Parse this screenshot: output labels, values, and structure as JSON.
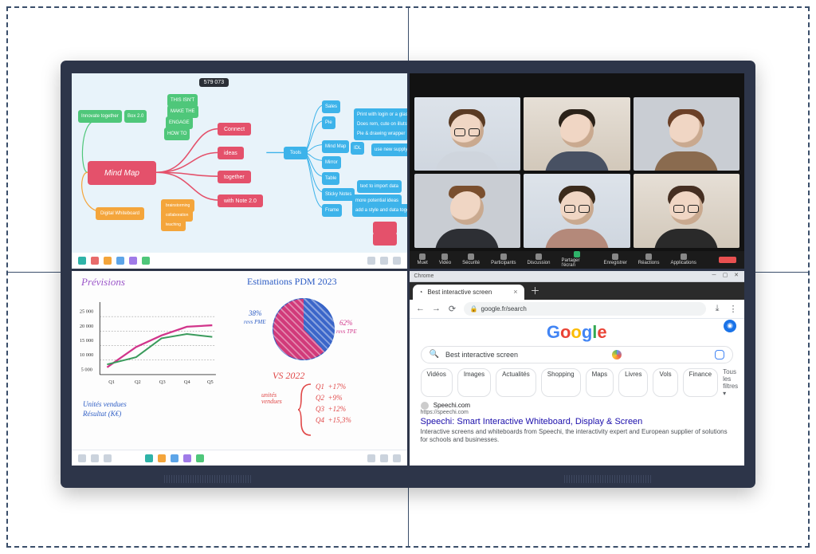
{
  "tl": {
    "badge": "579 073",
    "root": "Mind Map",
    "red_nodes": [
      "Connect",
      "ideas",
      "together",
      "with Note 2.0"
    ],
    "blue_center": "Tools",
    "blue_top": [
      "Sales",
      "Pie",
      "Mind Map",
      "Mirror",
      "Table",
      "Sticky Notes",
      "Frame"
    ],
    "blue_small": [
      "Print with login or a glass",
      "Does rem, cute on illutstre",
      "Pie & drawing wrapper",
      "IDL",
      "use new supply",
      "text to import data",
      "more potential ideas",
      "add a style and data together"
    ],
    "green_nodes": [
      "THIS ISN'T",
      "MAKE THE",
      "ENGAGE",
      "HOW TO"
    ],
    "green_box": "Box 2.0",
    "green_left": "Innovate together",
    "orange_root": "Digital Whiteboard",
    "orange_items": [
      "brainstorming",
      "collaboration",
      "teaching"
    ]
  },
  "tr": {
    "participants": [
      "",
      "",
      "",
      "",
      "",
      ""
    ],
    "controls": [
      "Muet",
      "Vidéo",
      "Sécurité",
      "Participants",
      "Discussion",
      "Partager l'écran",
      "Enregistrer",
      "Réactions",
      "Applications"
    ]
  },
  "bl": {
    "left_title": "Prévisions",
    "right_title": "Estimations PDM 2023",
    "ylabels": [
      "25 000",
      "20 000",
      "15 000",
      "10 000",
      "5 000"
    ],
    "xlabels": [
      "Q1",
      "Q2",
      "Q3",
      "Q4",
      "Q5"
    ],
    "legend1": "Unités vendues",
    "legend2": "Résultat (K€)",
    "pie_a": "38%",
    "pie_a_sub": "revs PME",
    "pie_b": "62%",
    "pie_b_sub": "revs TPE",
    "vs": "VS 2022",
    "vs_side": "unités vendues",
    "vs_rows": [
      {
        "q": "Q1",
        "v": "+17%"
      },
      {
        "q": "Q2",
        "v": "+9%"
      },
      {
        "q": "Q3",
        "v": "+12%"
      },
      {
        "q": "Q4",
        "v": "+15,3%"
      }
    ]
  },
  "br": {
    "window_app": "Chrome",
    "tab_title": "Best interactive screen",
    "url": "google.fr/search",
    "logo_letters": [
      "G",
      "o",
      "o",
      "g",
      "l",
      "e"
    ],
    "search_value": "Best interactive screen",
    "chips": [
      "Vidéos",
      "Images",
      "Actualités",
      "Shopping",
      "Maps",
      "Livres",
      "Vols",
      "Finance"
    ],
    "chips_more": "Tous les filtres ▾",
    "result_site": "Speechi.com",
    "result_url": "https://speechi.com",
    "result_title": "Speechi: Smart Interactive Whiteboard, Display & Screen",
    "result_desc": "Interactive screens and whiteboards from Speechi, the interactivity expert and European supplier of solutions for schools and businesses."
  },
  "chart_data": {
    "type": "line",
    "categories": [
      "Q1",
      "Q2",
      "Q3",
      "Q4",
      "Q5"
    ],
    "series": [
      {
        "name": "Unités vendues",
        "values": [
          4000,
          11000,
          15000,
          18000,
          19000
        ]
      },
      {
        "name": "Résultat (K€)",
        "values": [
          5000,
          7000,
          13000,
          15000,
          14000
        ]
      }
    ],
    "title": "Prévisions",
    "xlabel": "",
    "ylabel": "",
    "ylim": [
      0,
      25000
    ]
  }
}
